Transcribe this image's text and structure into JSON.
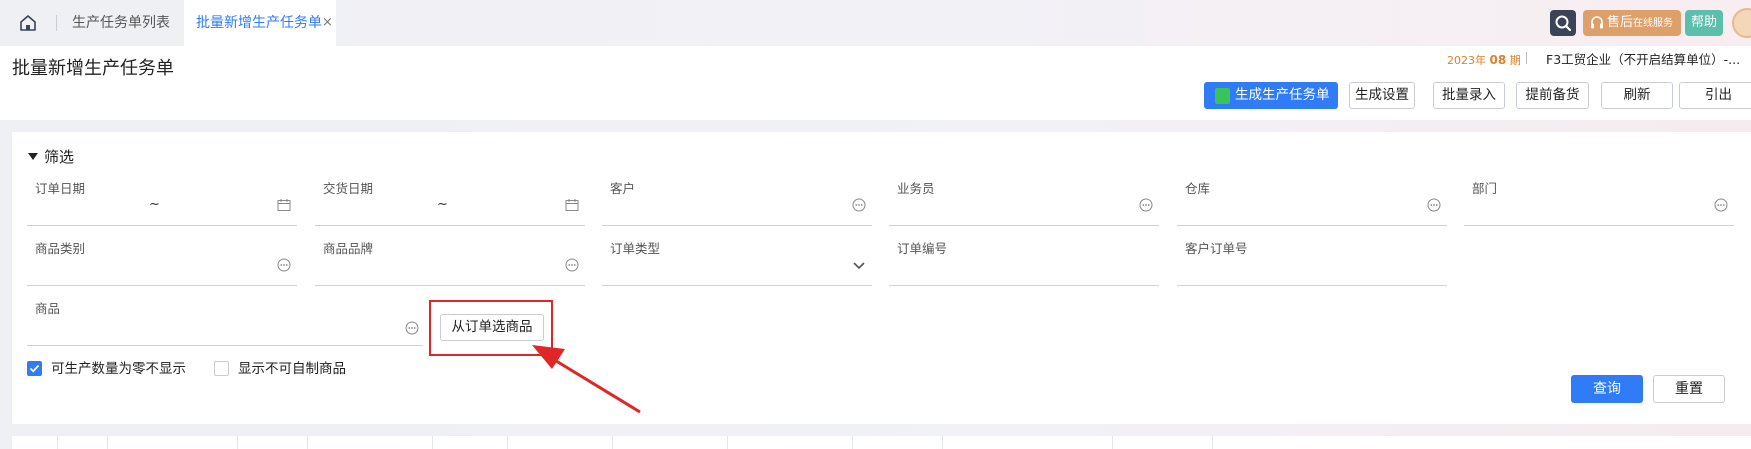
{
  "tabs": {
    "list_label": "生产任务单列表",
    "active_label": "批量新增生产任务单",
    "close_glyph": "×"
  },
  "topbar": {
    "service_label": "售后",
    "service_sub": "在线服务",
    "help_label": "帮助"
  },
  "header": {
    "title": "批量新增生产任务单",
    "period_year": "2023年",
    "period_num": "08",
    "period_unit": "期",
    "company": "F3工贸企业（不开启结算单位）-...",
    "buttons": {
      "generate": "生成生产任务单",
      "settings": "生成设置",
      "batch": "批量录入",
      "prestock": "提前备货",
      "refresh": "刷新",
      "export": "引出"
    }
  },
  "filter": {
    "toggle_label": "筛选",
    "fields": {
      "order_date": "订单日期",
      "delivery_date": "交货日期",
      "customer": "客户",
      "salesman": "业务员",
      "warehouse": "仓库",
      "department": "部门",
      "category": "商品类别",
      "brand": "商品品牌",
      "order_type": "订单类型",
      "order_no": "订单编号",
      "customer_order_no": "客户订单号",
      "product": "商品"
    },
    "range_sep": "~",
    "pick_from_order": "从订单选商品",
    "hide_zero": "可生产数量为零不显示",
    "hide_zero_checked": true,
    "show_non_self": "显示不可自制商品",
    "show_non_self_checked": false,
    "query": "查询",
    "reset": "重置"
  },
  "colors": {
    "primary": "#2f7cf6",
    "service": "#dea06a",
    "help": "#5bbfaa",
    "highlight": "#e02727"
  }
}
